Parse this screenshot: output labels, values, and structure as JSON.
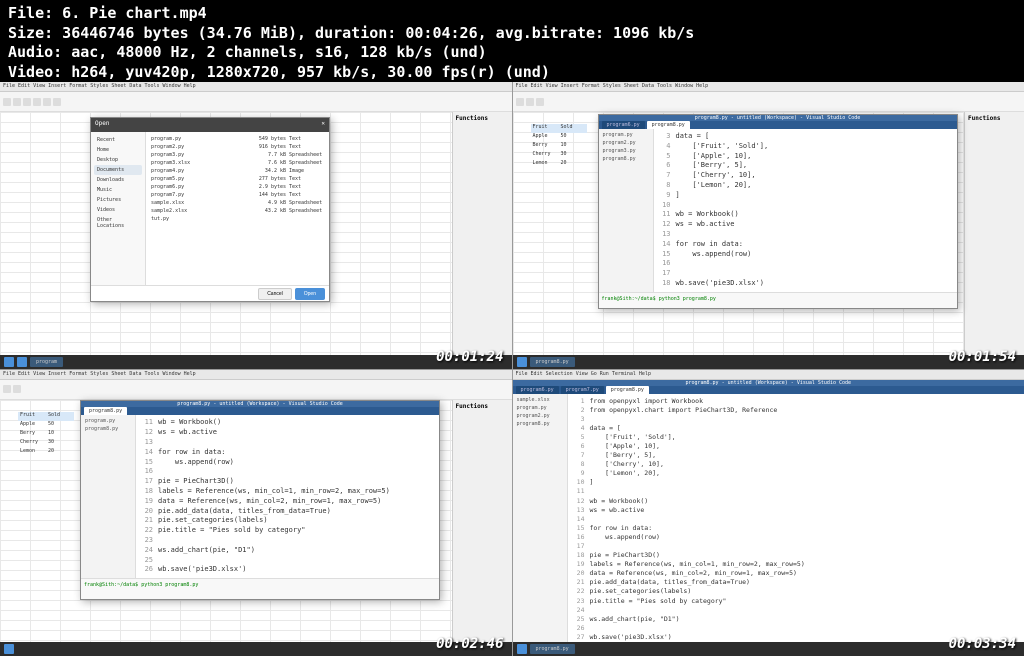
{
  "file_info": {
    "line1": "File: 6. Pie chart.mp4",
    "line2": "Size: 36446746 bytes (34.76 MiB), duration: 00:04:26, avg.bitrate: 1096 kb/s",
    "line3": "Audio: aac, 48000 Hz, 2 channels, s16, 128 kb/s (und)",
    "line4": "Video: h264, yuv420p, 1280x720, 957 kb/s, 30.00 fps(r) (und)"
  },
  "timestamps": {
    "q1": "00:01:24",
    "q2": "00:01:54",
    "q3": "00:02:46",
    "q4": "00:03:34"
  },
  "menubar": "File Edit View Insert Format Styles Sheet Data Tools Window Help",
  "sidebar_title": "Functions",
  "q1": {
    "dialog_title": "Open",
    "nav": [
      "Recent",
      "Home",
      "Desktop",
      "Documents",
      "Downloads",
      "Music",
      "Pictures",
      "Videos",
      "Other Locations"
    ],
    "files": [
      {
        "n": "program.py",
        "s": "549 bytes",
        "t": "Text"
      },
      {
        "n": "program2.py",
        "s": "916 bytes",
        "t": "Text"
      },
      {
        "n": "program3.py",
        "s": "7.7 kB",
        "t": "Spreadsheet"
      },
      {
        "n": "program3.xlsx",
        "s": "7.6 kB",
        "t": "Spreadsheet"
      },
      {
        "n": "program4.py",
        "s": "34.2 kB",
        "t": "Image"
      },
      {
        "n": "program5.py",
        "s": "277 bytes",
        "t": "Text"
      },
      {
        "n": "program6.py",
        "s": "2.9 bytes",
        "t": "Text"
      },
      {
        "n": "program7.py",
        "s": "144 bytes",
        "t": "Text"
      },
      {
        "n": "sample.xlsx",
        "s": "4.9 kB",
        "t": "Spreadsheet"
      },
      {
        "n": "sample2.xlsx",
        "s": "43.2 kB",
        "t": "Spreadsheet"
      },
      {
        "n": "tut.py",
        "s": "",
        "t": ""
      }
    ],
    "cancel": "Cancel",
    "open": "Open"
  },
  "q2": {
    "data": [
      [
        "Fruit",
        "Sold"
      ],
      [
        "Apple",
        "50"
      ],
      [
        "Berry",
        "10"
      ],
      [
        "Cherry",
        "30"
      ],
      [
        "Lemon",
        "20"
      ]
    ],
    "editor_title": "program8.py - untitled (Workspace) - Visual Studio Code",
    "code": [
      {
        "n": "3",
        "t": "data = ["
      },
      {
        "n": "4",
        "t": "    ['Fruit', 'Sold'],"
      },
      {
        "n": "5",
        "t": "    ['Apple', 10],"
      },
      {
        "n": "6",
        "t": "    ['Berry', 5],"
      },
      {
        "n": "7",
        "t": "    ['Cherry', 10],"
      },
      {
        "n": "8",
        "t": "    ['Lemon', 20],"
      },
      {
        "n": "9",
        "t": "]"
      },
      {
        "n": "10",
        "t": ""
      },
      {
        "n": "11",
        "t": "wb = Workbook()"
      },
      {
        "n": "12",
        "t": "ws = wb.active"
      },
      {
        "n": "13",
        "t": ""
      },
      {
        "n": "14",
        "t": "for row in data:"
      },
      {
        "n": "15",
        "t": "    ws.append(row)"
      },
      {
        "n": "16",
        "t": ""
      },
      {
        "n": "17",
        "t": ""
      },
      {
        "n": "18",
        "t": "wb.save('pie3D.xlsx')"
      }
    ],
    "terminal": "frank@Sith:~/data$ python3 program8.py"
  },
  "q3": {
    "data": [
      [
        "Fruit",
        "Sold"
      ],
      [
        "Apple",
        "50"
      ],
      [
        "Berry",
        "10"
      ],
      [
        "Cherry",
        "30"
      ],
      [
        "Lemon",
        "20"
      ]
    ],
    "code": [
      {
        "n": "11",
        "t": "wb = Workbook()"
      },
      {
        "n": "12",
        "t": "ws = wb.active"
      },
      {
        "n": "13",
        "t": ""
      },
      {
        "n": "14",
        "t": "for row in data:"
      },
      {
        "n": "15",
        "t": "    ws.append(row)"
      },
      {
        "n": "16",
        "t": ""
      },
      {
        "n": "17",
        "t": "pie = PieChart3D()"
      },
      {
        "n": "18",
        "t": "labels = Reference(ws, min_col=1, min_row=2, max_row=5)"
      },
      {
        "n": "19",
        "t": "data = Reference(ws, min_col=2, min_row=1, max_row=5)"
      },
      {
        "n": "20",
        "t": "pie.add_data(data, titles_from_data=True)"
      },
      {
        "n": "21",
        "t": "pie.set_categories(labels)"
      },
      {
        "n": "22",
        "t": "pie.title = \"Pies sold by category\""
      },
      {
        "n": "23",
        "t": ""
      },
      {
        "n": "24",
        "t": "ws.add_chart(pie, \"D1\")"
      },
      {
        "n": "25",
        "t": ""
      },
      {
        "n": "26",
        "t": "wb.save('pie3D.xlsx')"
      }
    ],
    "terminal": "frank@Sith:~/data$ python3 program8.py"
  },
  "q4": {
    "code": [
      {
        "n": "1",
        "t": "from openpyxl import Workbook"
      },
      {
        "n": "2",
        "t": "from openpyxl.chart import PieChart3D, Reference"
      },
      {
        "n": "3",
        "t": ""
      },
      {
        "n": "4",
        "t": "data = ["
      },
      {
        "n": "5",
        "t": "    ['Fruit', 'Sold'],"
      },
      {
        "n": "6",
        "t": "    ['Apple', 10],"
      },
      {
        "n": "7",
        "t": "    ['Berry', 5],"
      },
      {
        "n": "8",
        "t": "    ['Cherry', 10],"
      },
      {
        "n": "9",
        "t": "    ['Lemon', 20],"
      },
      {
        "n": "10",
        "t": "]"
      },
      {
        "n": "11",
        "t": ""
      },
      {
        "n": "12",
        "t": "wb = Workbook()"
      },
      {
        "n": "13",
        "t": "ws = wb.active"
      },
      {
        "n": "14",
        "t": ""
      },
      {
        "n": "15",
        "t": "for row in data:"
      },
      {
        "n": "16",
        "t": "    ws.append(row)"
      },
      {
        "n": "17",
        "t": ""
      },
      {
        "n": "18",
        "t": "pie = PieChart3D()"
      },
      {
        "n": "19",
        "t": "labels = Reference(ws, min_col=1, min_row=2, max_row=5)"
      },
      {
        "n": "20",
        "t": "data = Reference(ws, min_col=2, min_row=1, max_row=5)"
      },
      {
        "n": "21",
        "t": "pie.add_data(data, titles_from_data=True)"
      },
      {
        "n": "22",
        "t": "pie.set_categories(labels)"
      },
      {
        "n": "23",
        "t": "pie.title = \"Pies sold by category\""
      },
      {
        "n": "24",
        "t": ""
      },
      {
        "n": "25",
        "t": "ws.add_chart(pie, \"D1\")"
      },
      {
        "n": "26",
        "t": ""
      },
      {
        "n": "27",
        "t": "wb.save('pie3D.xlsx')"
      }
    ],
    "terminal": "frank@Sith:~/data$ python3 program8.py"
  }
}
